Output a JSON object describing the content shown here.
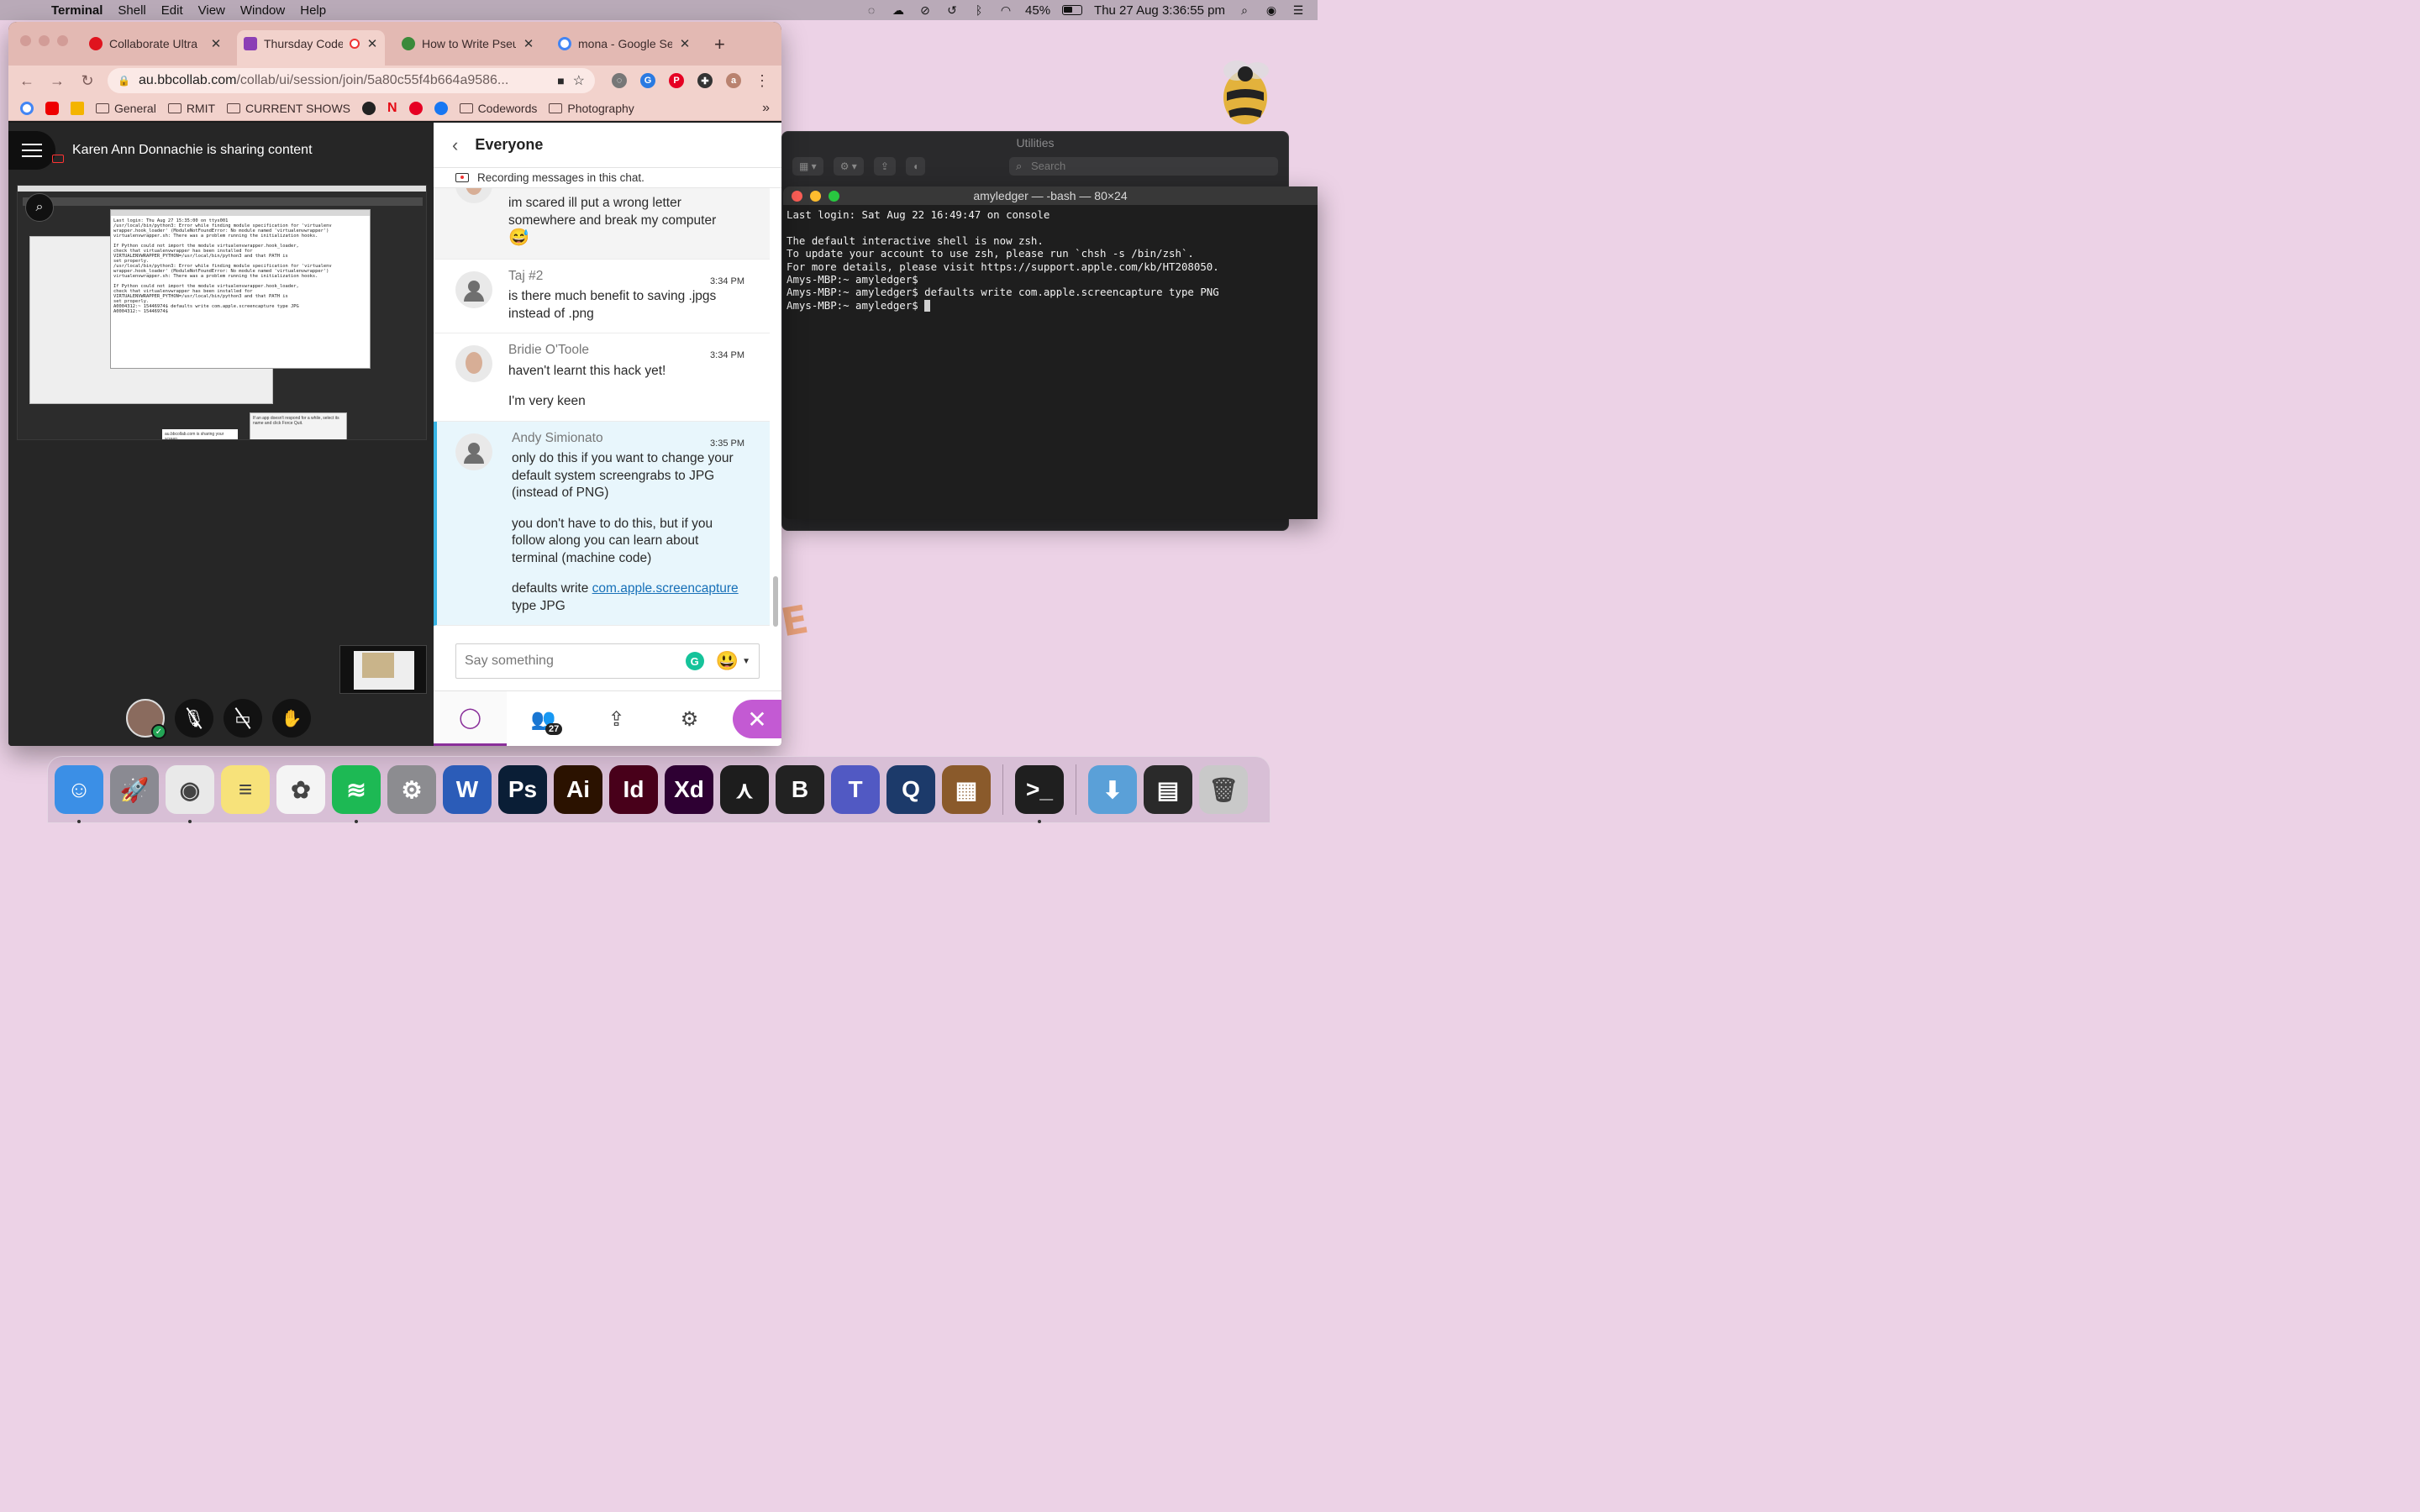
{
  "menubar": {
    "app": "Terminal",
    "items": [
      "Shell",
      "Edit",
      "View",
      "Window",
      "Help"
    ],
    "battery": "45%",
    "datetime": "Thu 27 Aug  3:36:55 pm"
  },
  "chrome": {
    "tabs": [
      {
        "label": "Collaborate Ultra",
        "color": "#e0141e"
      },
      {
        "label": "Thursday Code",
        "color": "#8b3fb5"
      },
      {
        "label": "How to Write Pseu",
        "color": "#3a8a3a"
      },
      {
        "label": "mona - Google Sea",
        "color": "#4285f4"
      }
    ],
    "url_host": "au.bbcollab.com",
    "url_path": "/collab/ui/session/join/5a80c55f4b664a9586...",
    "bookmarks": [
      "General",
      "RMIT",
      "CURRENT SHOWS",
      "Codewords",
      "Photography"
    ],
    "more": "»"
  },
  "collab": {
    "sharing_text": "Karen Ann Donnachie is sharing content",
    "shared_terminal_lines": "Last login: Thu Aug 27 15:35:00 on ttys001\n/usr/local/bin/python3: Error while finding module specification for 'virtualenv\nwrapper.hook_loader' (ModuleNotFoundError: No module named 'virtualenvwrapper')\nvirtualenvwrapper.sh: There was a problem running the initialization hooks.\n\nIf Python could not import the module virtualenvwrapper.hook_loader,\ncheck that virtualenvwrapper has been installed for\nVIRTUALENVWRAPPER_PYTHON=/usr/local/bin/python3 and that PATH is\nset properly.\n/usr/local/bin/python3: Error while finding module specification for 'virtualenv\nwrapper.hook_loader' (ModuleNotFoundError: No module named 'virtualenvwrapper')\nvirtualenvwrapper.sh: There was a problem running the initialization hooks.\n\nIf Python could not import the module virtualenvwrapper.hook_loader,\ncheck that virtualenvwrapper has been installed for\nVIRTUALENVWRAPPER_PYTHON=/usr/local/bin/python3 and that PATH is\nset properly.\nA0004312:~ 15446974$ defaults write com.apple.screencapture type JPG\nA0004312:~ 15446974$ ",
    "shared_popup": "au.bbcollab.com is sharing your screen.",
    "shared_popup2": "If an app doesn't respond for a while, select its name and click Force Quit."
  },
  "chat": {
    "title": "Everyone",
    "recording_note": "Recording messages in this chat.",
    "messages": [
      {
        "name": "",
        "time": "",
        "lines": [
          "im scared ill put a wrong letter somewhere and break my computer"
        ],
        "emoji": "😅"
      },
      {
        "name": "Taj #2",
        "time": "3:34 PM",
        "lines": [
          "is there much benefit to saving .jpgs instead of .png"
        ]
      },
      {
        "name": "Bridie O'Toole",
        "time": "3:34 PM",
        "lines": [
          "haven't learnt this hack yet!",
          "I'm very keen"
        ]
      },
      {
        "name": "Andy Simionato",
        "time": "3:35 PM",
        "lines": [
          "only do this if you want to change your default system screengrabs to JPG (instead of PNG)",
          "you don't have to do this, but if you follow along you can learn about terminal (machine code)"
        ],
        "cmd_prefix": "defaults write ",
        "cmd_link": "com.apple.screencapture",
        "cmd_suffix": "type JPG"
      }
    ],
    "compose_placeholder": "Say something",
    "participants_count": "27"
  },
  "finder": {
    "title": "Utilities",
    "search_placeholder": "Search"
  },
  "terminal": {
    "title": "amyledger — -bash — 80×24",
    "output": "Last login: Sat Aug 22 16:49:47 on console\n\nThe default interactive shell is now zsh.\nTo update your account to use zsh, please run `chsh -s /bin/zsh`.\nFor more details, please visit https://support.apple.com/kb/HT208050.\nAmys-MBP:~ amyledger$\nAmys-MBP:~ amyledger$ defaults write com.apple.screencapture type PNG\nAmys-MBP:~ amyledger$ "
  },
  "dock": {
    "apps": [
      {
        "name": "Finder",
        "label": "☺",
        "color": "#3b8fe6",
        "running": true
      },
      {
        "name": "Launchpad",
        "label": "🚀",
        "color": "#8a8a92",
        "running": false
      },
      {
        "name": "Chrome",
        "label": "◉",
        "color": "#e9e9e9",
        "running": true
      },
      {
        "name": "Notes",
        "label": "≡",
        "color": "#f7e27a",
        "running": false
      },
      {
        "name": "Photos",
        "label": "✿",
        "color": "#f4f4f4",
        "running": false
      },
      {
        "name": "Spotify",
        "label": "≋",
        "color": "#1db954",
        "running": true
      },
      {
        "name": "System Preferences",
        "label": "⚙",
        "color": "#8c8c90",
        "running": false
      },
      {
        "name": "Word",
        "label": "W",
        "color": "#2b5cb8",
        "running": false
      },
      {
        "name": "Photoshop",
        "label": "Ps",
        "color": "#0a1e36",
        "running": false
      },
      {
        "name": "Illustrator",
        "label": "Ai",
        "color": "#2b1200",
        "running": false
      },
      {
        "name": "InDesign",
        "label": "Id",
        "color": "#48001a",
        "running": false
      },
      {
        "name": "XD",
        "label": "Xd",
        "color": "#2e0033",
        "running": false
      },
      {
        "name": "Acrobat",
        "label": "⋏",
        "color": "#1d1d1d",
        "running": false
      },
      {
        "name": "Brackets",
        "label": "B",
        "color": "#222",
        "running": false
      },
      {
        "name": "Teams",
        "label": "T",
        "color": "#5159c3",
        "running": false
      },
      {
        "name": "QuickTime",
        "label": "Q",
        "color": "#1c3a6a",
        "running": false
      },
      {
        "name": "Minecraft",
        "label": "▦",
        "color": "#8a5a2b",
        "running": false
      },
      {
        "name": "Terminal",
        "label": ">_",
        "color": "#1f1f1f",
        "running": true
      },
      {
        "name": "Downloads",
        "label": "⬇",
        "color": "#5aa0d8",
        "running": false
      },
      {
        "name": "Activity",
        "label": "▤",
        "color": "#2a2a2a",
        "running": false
      },
      {
        "name": "Trash",
        "label": "🗑",
        "color": "#c9c9c9",
        "running": false
      }
    ]
  }
}
